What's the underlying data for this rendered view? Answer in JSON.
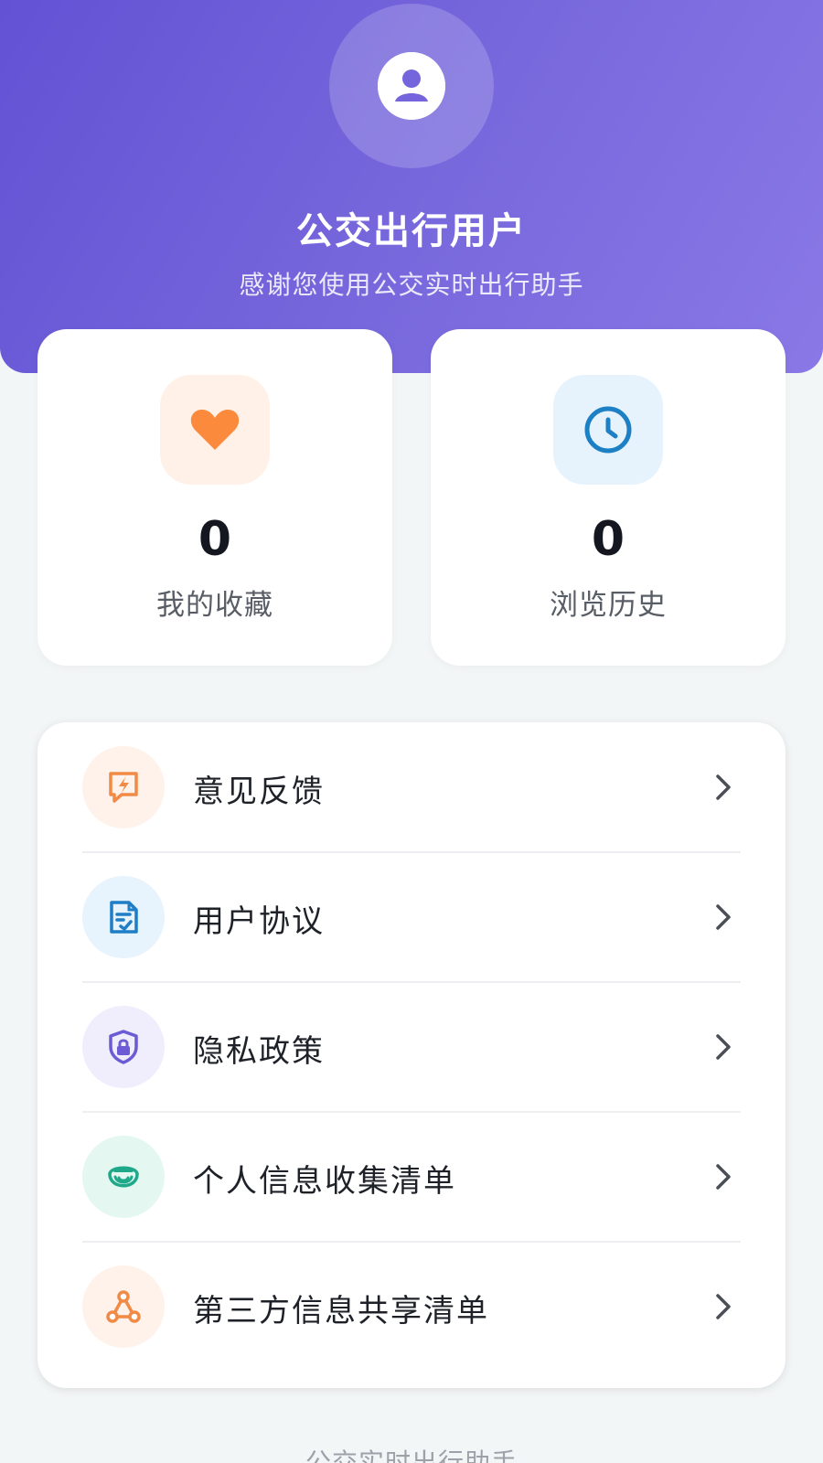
{
  "header": {
    "username": "公交出行用户",
    "tagline": "感谢您使用公交实时出行助手",
    "avatar_icon": "user-icon"
  },
  "stats": [
    {
      "icon": "heart-icon",
      "value": "0",
      "label": "我的收藏",
      "color": "#fb8a3c",
      "bg": "#fff1e8"
    },
    {
      "icon": "clock-icon",
      "value": "0",
      "label": "浏览历史",
      "color": "#1d7fc4",
      "bg": "#e6f3fd"
    }
  ],
  "menu": [
    {
      "label": "意见反馈",
      "icon": "feedback-icon",
      "color": "#f08a45",
      "bg": "#fff2ea"
    },
    {
      "label": "用户协议",
      "icon": "document-icon",
      "color": "#1f7ec5",
      "bg": "#e7f3fd"
    },
    {
      "label": "隐私政策",
      "icon": "shield-lock-icon",
      "color": "#6b5bd4",
      "bg": "#f0edfd"
    },
    {
      "label": "个人信息收集清单",
      "icon": "info-collect-icon",
      "color": "#1fa98a",
      "bg": "#e5f7f1"
    },
    {
      "label": "第三方信息共享清单",
      "icon": "share-icon",
      "color": "#f08a45",
      "bg": "#fff2ea"
    }
  ],
  "footer": {
    "text": "公交实时出行助手"
  },
  "colors": {
    "header_start": "#6352d4",
    "header_end": "#8a78e6",
    "background": "#f3f6f7"
  }
}
